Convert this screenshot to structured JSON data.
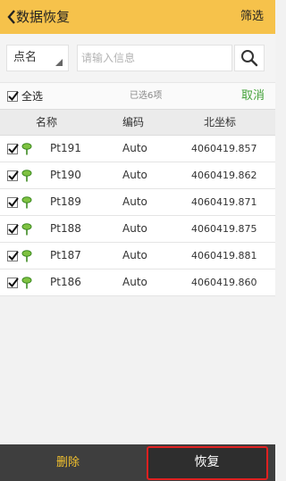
{
  "header": {
    "title": "数据恢复",
    "filter_label": "筛选"
  },
  "search": {
    "field": "点名",
    "placeholder": "请输入信息"
  },
  "selection": {
    "select_all_label": "全选",
    "count_text": "已选6项",
    "cancel_label": "取消"
  },
  "table": {
    "columns": [
      "名称",
      "编码",
      "北坐标"
    ],
    "rows": [
      {
        "name": "Pt191",
        "code": "Auto",
        "north": "4060419.857"
      },
      {
        "name": "Pt190",
        "code": "Auto",
        "north": "4060419.862"
      },
      {
        "name": "Pt189",
        "code": "Auto",
        "north": "4060419.871"
      },
      {
        "name": "Pt188",
        "code": "Auto",
        "north": "4060419.875"
      },
      {
        "name": "Pt187",
        "code": "Auto",
        "north": "4060419.881"
      },
      {
        "name": "Pt186",
        "code": "Auto",
        "north": "4060419.860"
      }
    ]
  },
  "footer": {
    "delete_label": "删除",
    "restore_label": "恢复"
  },
  "colors": {
    "header": "#f6c24b",
    "accent_green": "#44a23a",
    "delete_text": "#f2c12e",
    "highlight": "#e02020"
  },
  "icons": [
    "back-chevron-icon",
    "dropdown-triangle-icon",
    "search-icon",
    "checkbox-checked-icon",
    "point-pin-icon"
  ]
}
